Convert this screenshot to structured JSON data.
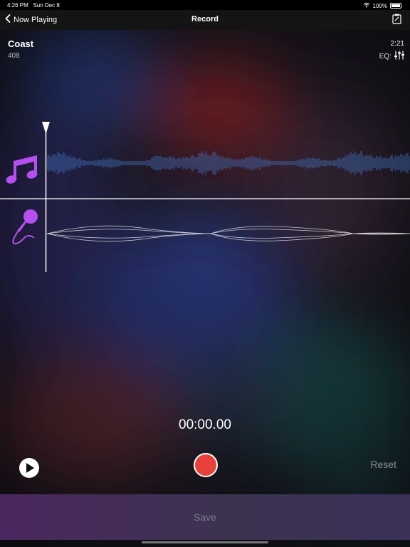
{
  "status": {
    "time": "4:26 PM",
    "date": "Sun Dec 8",
    "battery": "100%",
    "wifi_icon": "wifi-icon",
    "battery_icon": "battery-icon"
  },
  "nav": {
    "back_label": "Now Playing",
    "title": "Record",
    "right_icon": "clipboard-icon"
  },
  "song": {
    "title": "Coast",
    "subtitle": "408",
    "duration": "2:21",
    "eq_label": "EQ:"
  },
  "tracks": {
    "music_icon": "music-note-icon",
    "mic_icon": "microphone-icon",
    "music_color": "#b64ff0",
    "waveform_color": "#3f6db5"
  },
  "controls": {
    "timer": "00:00.00",
    "reset_label": "Reset",
    "save_label": "Save",
    "record_color": "#e8403a"
  }
}
